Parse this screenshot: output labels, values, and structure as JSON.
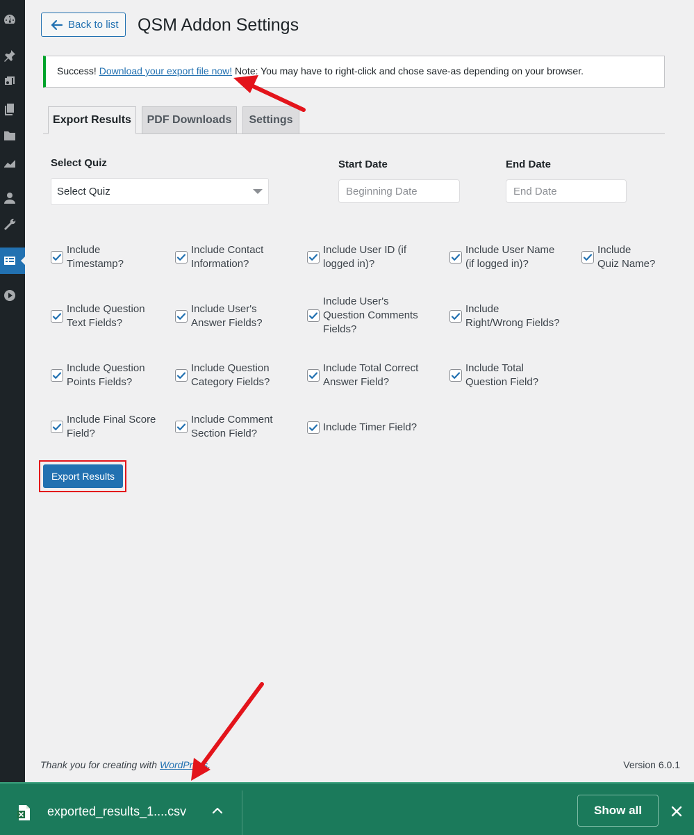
{
  "sidebar": {
    "icons": [
      "dashboard-icon",
      "pin-icon",
      "media-icon",
      "pages-icon",
      "folder-icon",
      "chart-icon",
      "users-icon",
      "tools-icon",
      "forms-icon",
      "play-icon"
    ],
    "active": "forms-icon"
  },
  "header": {
    "back_label": "Back to list",
    "title": "QSM Addon Settings"
  },
  "notice": {
    "prefix": "Success!",
    "link": "Download your export file now!",
    "suffix": "Note: You may have to right-click and chose save-as depending on your browser."
  },
  "tabs": [
    {
      "label": "Export Results",
      "active": true
    },
    {
      "label": "PDF Downloads",
      "active": false
    },
    {
      "label": "Settings",
      "active": false
    }
  ],
  "form": {
    "select_quiz_label": "Select Quiz",
    "select_quiz_value": "Select Quiz",
    "start_date_label": "Start Date",
    "start_date_placeholder": "Beginning Date",
    "end_date_label": "End Date",
    "end_date_placeholder": "End Date",
    "checkboxes": [
      {
        "lines": [
          "Include",
          "Timestamp?"
        ],
        "checked": true
      },
      {
        "lines": [
          "Include Contact",
          "Information?"
        ],
        "checked": true
      },
      {
        "lines": [
          "Include User ID (if",
          "logged in)?"
        ],
        "checked": true
      },
      {
        "lines": [
          "Include User Name",
          "(if logged in)?"
        ],
        "checked": true
      },
      {
        "lines": [
          "Include",
          "Quiz Name?"
        ],
        "checked": true
      },
      {
        "lines": [
          "Include Question",
          "Text Fields?"
        ],
        "checked": true
      },
      {
        "lines": [
          "Include User's",
          "Answer Fields?"
        ],
        "checked": true
      },
      {
        "lines": [
          "Include User's",
          "Question Comments",
          "Fields?"
        ],
        "checked": true
      },
      {
        "lines": [
          "Include",
          "Right/Wrong Fields?"
        ],
        "checked": true
      },
      {
        "lines": [
          "Include Question",
          "Points Fields?"
        ],
        "checked": true
      },
      {
        "lines": [
          "Include Question",
          "Category Fields?"
        ],
        "checked": true
      },
      {
        "lines": [
          "Include Total Correct",
          "Answer Field?"
        ],
        "checked": true
      },
      {
        "lines": [
          "Include Total",
          "Question Field?"
        ],
        "checked": true
      },
      {
        "lines": [
          "Include Final Score",
          "Field?"
        ],
        "checked": true
      },
      {
        "lines": [
          "Include Comment",
          "Section Field?"
        ],
        "checked": true
      },
      {
        "lines": [
          "Include Timer Field?"
        ],
        "checked": true
      }
    ],
    "export_button": "Export Results"
  },
  "footer": {
    "thanks_prefix": "Thank you for creating with",
    "thanks_link": "WordPress",
    "thanks_suffix": ".",
    "version": "Version 6.0.1"
  },
  "download_bar": {
    "file_name": "exported_results_1....csv",
    "show_all": "Show all"
  },
  "colors": {
    "accent": "#2271b1",
    "success": "#00a32a",
    "annotation": "#e3141b",
    "download_bar": "#1b7a5b"
  }
}
